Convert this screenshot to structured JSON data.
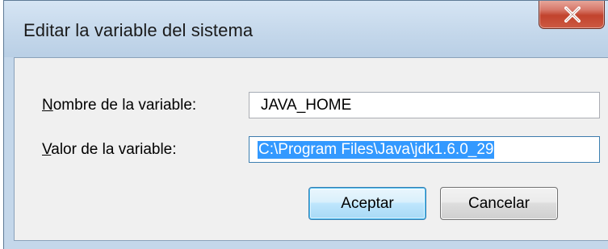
{
  "window": {
    "title": "Editar la variable del sistema",
    "close_icon": "close-icon"
  },
  "fields": {
    "name": {
      "label_mnemonic": "N",
      "label_rest": "ombre de la variable:",
      "value": "JAVA_HOME"
    },
    "value": {
      "label_mnemonic": "V",
      "label_rest": "alor de la variable:",
      "value": "C:\\Program Files\\Java\\jdk1.6.0_29",
      "selected": true
    }
  },
  "buttons": {
    "ok_mnemonic": "A",
    "ok_rest": "ceptar",
    "cancel_label": "Cancelar"
  },
  "colors": {
    "selection": "#3399ff",
    "close_button": "#c2432d",
    "title_bar": "#c5d8eb",
    "client_background": "#f0f0f0"
  }
}
